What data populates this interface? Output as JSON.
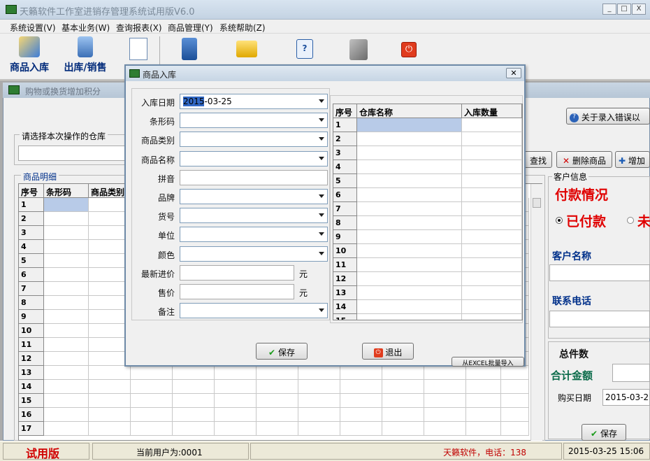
{
  "window": {
    "title": "天籟软件工作室进销存管理系统试用版V6.0",
    "min": "_",
    "max": "□",
    "close": "X"
  },
  "menu": [
    "系统设置(V)",
    "基本业务(W)",
    "查询报表(X)",
    "商品管理(Y)",
    "系统帮助(Z)"
  ],
  "toolbar": {
    "stock_in": "商品入库",
    "stock_out": "出库/销售"
  },
  "child": {
    "title": "购物或换货增加积分"
  },
  "warehouse": {
    "legend": "请选择本次操作的仓库"
  },
  "detail": {
    "legend": "商品明细",
    "headers": [
      "序号",
      "条形码",
      "商品类别"
    ],
    "rows": [
      "1",
      "2",
      "3",
      "4",
      "5",
      "6",
      "7",
      "8",
      "9",
      "10",
      "11",
      "12",
      "13",
      "14",
      "15",
      "16",
      "17"
    ]
  },
  "buttons": {
    "help": "关于录入错误以",
    "find": "查找",
    "delete": "删除商品",
    "add": "增加"
  },
  "customer": {
    "legend": "客户信息",
    "payment_title": "付款情况",
    "paid": "已付款",
    "unpaid": "未",
    "name_label": "客户名称",
    "phone_label": "联系电话",
    "total_count": "总件数",
    "total_amount": "合计金额",
    "buy_date_label": "购买日期",
    "buy_date": "2015-03-2",
    "save": "保存"
  },
  "status": {
    "trial": "试用版",
    "user": "当前用户为:0001",
    "company": "天籁软件，电话：138",
    "datetime": "2015-03-25 15:06"
  },
  "dialog": {
    "title": "商品入库",
    "fields": [
      {
        "label": "入库日期",
        "value": "2015-03-25",
        "kind": "combo"
      },
      {
        "label": "条形码",
        "value": "",
        "kind": "combo"
      },
      {
        "label": "商品类别",
        "value": "",
        "kind": "combo"
      },
      {
        "label": "商品名称",
        "value": "",
        "kind": "combo"
      },
      {
        "label": "拼音",
        "value": "",
        "kind": "text"
      },
      {
        "label": "品牌",
        "value": "",
        "kind": "combo"
      },
      {
        "label": "货号",
        "value": "",
        "kind": "combo"
      },
      {
        "label": "单位",
        "value": "",
        "kind": "combo"
      },
      {
        "label": "颜色",
        "value": "",
        "kind": "combo"
      },
      {
        "label": "最新进价",
        "value": "",
        "kind": "money"
      },
      {
        "label": "售价",
        "value": "",
        "kind": "money"
      },
      {
        "label": "备注",
        "value": "",
        "kind": "combo"
      }
    ],
    "unit_yuan": "元",
    "grid_headers": [
      "序号",
      "仓库名称",
      "入库数量"
    ],
    "grid_rows": [
      "1",
      "2",
      "3",
      "4",
      "5",
      "6",
      "7",
      "8",
      "9",
      "10",
      "11",
      "12",
      "13",
      "14",
      "15"
    ],
    "save": "保存",
    "exit": "退出",
    "excel": "从EXCEL批量导入"
  },
  "colors": {
    "accent_red": "#e00000",
    "label_blue": "#002a7a",
    "title_blue": "#c6d5e4"
  }
}
